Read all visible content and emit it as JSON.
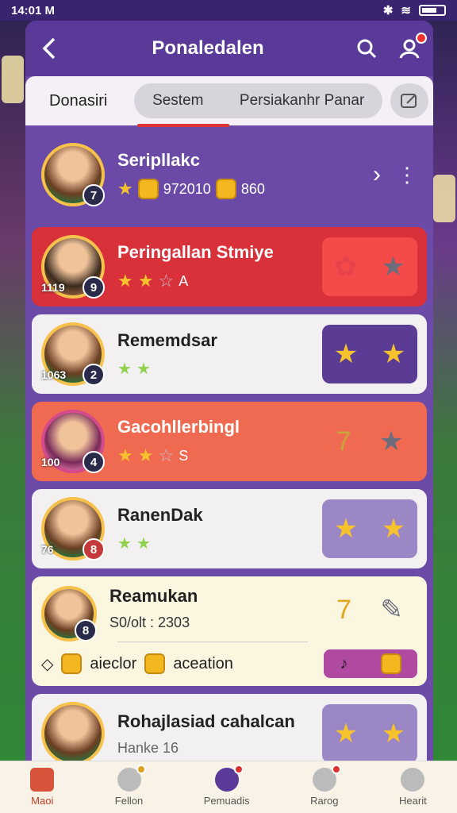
{
  "status": {
    "time": "14:01 M",
    "battery_icon": "battery-icon"
  },
  "header": {
    "title": "Ponaledalen"
  },
  "tabs": {
    "main": "Donasiri",
    "tab1": "Sestem",
    "tab2": "Persiakanhr Panar"
  },
  "featured": {
    "name": "Seripllakc",
    "level": "7",
    "coins": "972010",
    "bonus": "860"
  },
  "rows": [
    {
      "name": "Peringallan Stmiye",
      "score": "1119",
      "level": "9",
      "meta": "A"
    },
    {
      "name": "Rememdsar",
      "score": "1063",
      "level": "2"
    },
    {
      "name": "Gacohllerbingl",
      "score": "100",
      "level": "4",
      "meta": "S"
    },
    {
      "name": "RanenDak",
      "score": "76",
      "level": "8"
    },
    {
      "name": "Reamukan",
      "meta": "S0/olt : 2303",
      "bottom1": "aieclor",
      "bottom2": "aceation",
      "level": "8"
    },
    {
      "name": "Rohajlasiad cahalcan",
      "meta": "Hanke 16"
    }
  ],
  "nav": {
    "home": "Maoi",
    "friends": "Fellon",
    "match": "Pemuadis",
    "rank": "Rarog",
    "profile": "Hearit"
  }
}
